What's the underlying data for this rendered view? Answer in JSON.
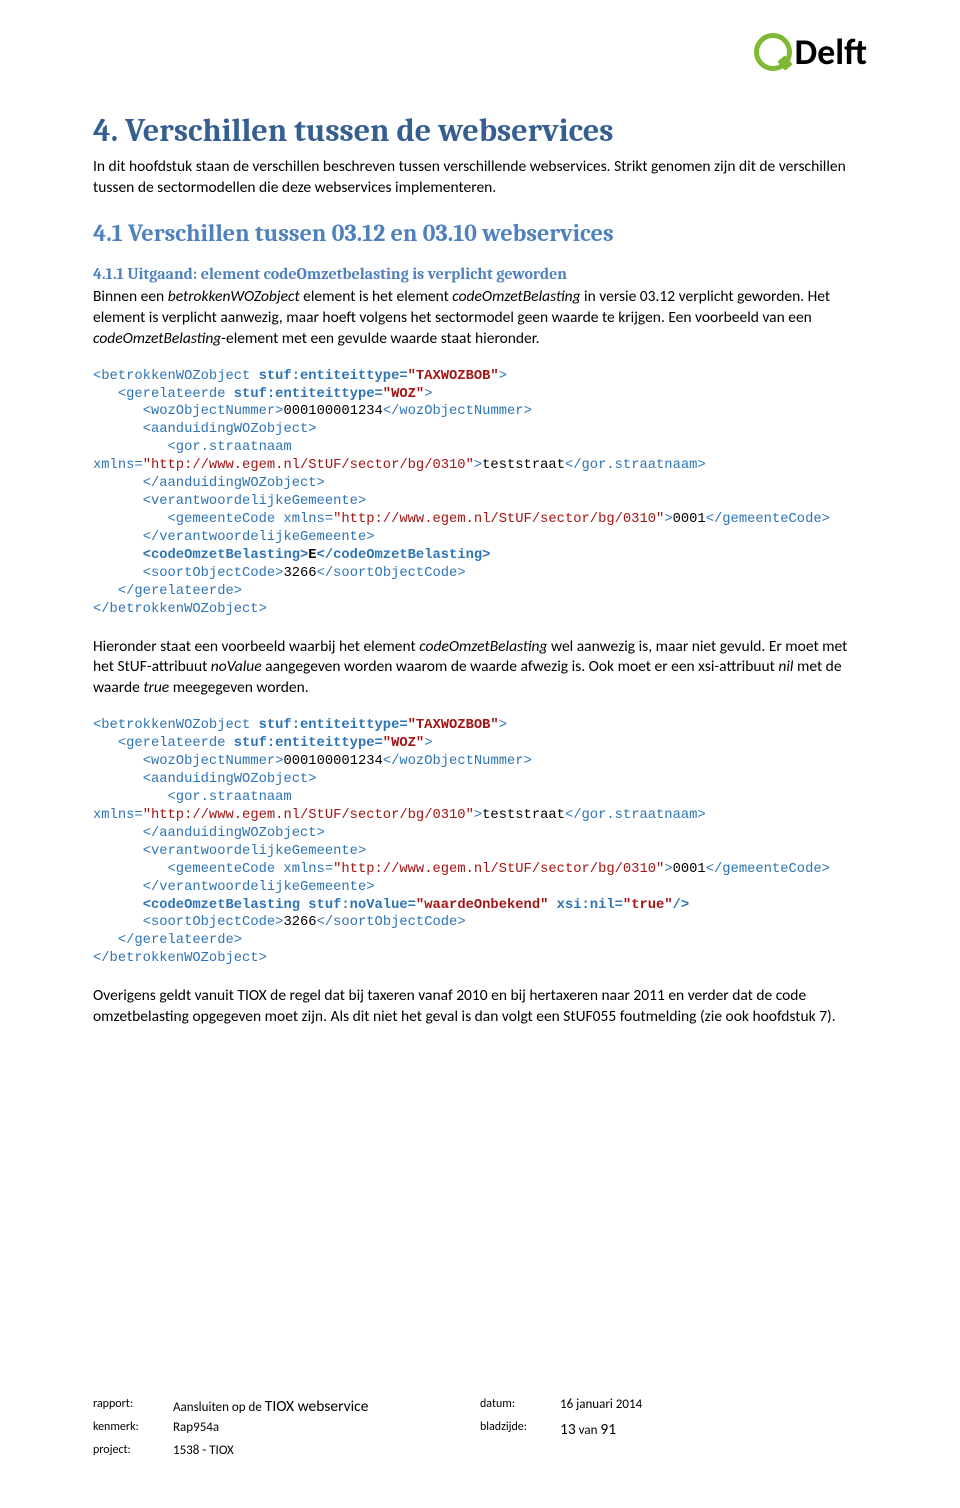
{
  "logo": {
    "text": "Delft"
  },
  "h1": "4. Verschillen tussen de webservices",
  "intro": "In dit hoofdstuk staan de verschillen beschreven tussen verschillende webservices. Strikt genomen zijn dit de verschillen tussen de sectormodellen die deze webservices implementeren.",
  "h2": "4.1 Verschillen tussen 03.12 en 03.10 webservices",
  "h3": "4.1.1 Uitgaand: element codeOmzetbelasting is verplicht geworden",
  "p1a": "Binnen een ",
  "p1b": "betrokkenWOZobject",
  "p1c": " element is het element ",
  "p1d": "codeOmzetBelasting",
  "p1e": " in versie 03.12 verplicht geworden. Het element is verplicht aanwezig, maar hoeft volgens het sectormodel geen waarde te krijgen. Een voorbeeld van een ",
  "p1f": "codeOmzetBelasting",
  "p1g": "-element met een gevulde waarde staat hieronder.",
  "code1": {
    "l01a": "<betrokkenWOZobject",
    "l01b": " stuf:entiteittype=",
    "l01c": "\"TAXWOZBOB\"",
    "l01d": ">",
    "l02a": "   <gerelateerde",
    "l02b": " stuf:entiteittype=",
    "l02c": "\"WOZ\"",
    "l02d": ">",
    "l03a": "      <wozObjectNummer>",
    "l03b": "000100001234",
    "l03c": "</wozObjectNummer>",
    "l04": "      <aanduidingWOZobject>",
    "l05a": "         <gor.straatnaam",
    "l06a": "xmlns=",
    "l06b": "\"http://www.egem.nl/StUF/sector/bg/0310\"",
    "l06c": ">",
    "l06d": "teststraat",
    "l06e": "</gor.straatnaam>",
    "l07": "      </aanduidingWOZobject>",
    "l08": "      <verantwoordelijkeGemeente>",
    "l09a": "         <gemeenteCode",
    "l09b": " xmlns=",
    "l09c": "\"http://www.egem.nl/StUF/sector/bg/0310\"",
    "l09d": ">",
    "l09e": "0001",
    "l09f": "</gemeenteCode>",
    "l10": "      </verantwoordelijkeGemeente>",
    "l11a": "      <codeOmzetBelasting>",
    "l11b": "E",
    "l11c": "</codeOmzetBelasting>",
    "l12a": "      <soortObjectCode>",
    "l12b": "3266",
    "l12c": "</soortObjectCode>",
    "l13": "   </gerelateerde>",
    "l14": "</betrokkenWOZobject>"
  },
  "p2a": "Hieronder staat een voorbeeld waarbij het element ",
  "p2b": "codeOmzetBelasting",
  "p2c": " wel aanwezig is, maar niet gevuld. Er moet met het StUF-attribuut ",
  "p2d": "noValue",
  "p2e": " aangegeven worden waarom de waarde afwezig is. Ook moet er een xsi-attribuut ",
  "p2f": "nil",
  "p2g": " met de waarde ",
  "p2h": "true",
  "p2i": " meegegeven worden.",
  "code2": {
    "l11a": "      <codeOmzetBelasting",
    "l11b": " stuf:noValue=",
    "l11c": "\"waardeOnbekend\"",
    "l11d": " xsi:nil=",
    "l11e": "\"true\"",
    "l11f": "/>"
  },
  "p3": "Overigens geldt vanuit TIOX de regel dat bij taxeren vanaf 2010 en bij hertaxeren  naar 2011 en verder dat de code omzetbelasting opgegeven moet zijn. Als dit niet het geval is dan volgt een StUF055 foutmelding (zie ook hoofdstuk 7).",
  "footer": {
    "rapport_lbl": "rapport:",
    "rapport_a": "Aansluiten op de ",
    "rapport_b": "TIOX webservice",
    "datum_lbl": "datum:",
    "datum": "16 januari 2014",
    "kenmerk_lbl": "kenmerk:",
    "kenmerk": "Rap954a",
    "bladzijde_lbl": "bladzijde:",
    "bladzijde_a": "13",
    "bladzijde_b": " van ",
    "bladzijde_c": "91",
    "project_lbl": "project:",
    "project": "1538 - TIOX"
  }
}
